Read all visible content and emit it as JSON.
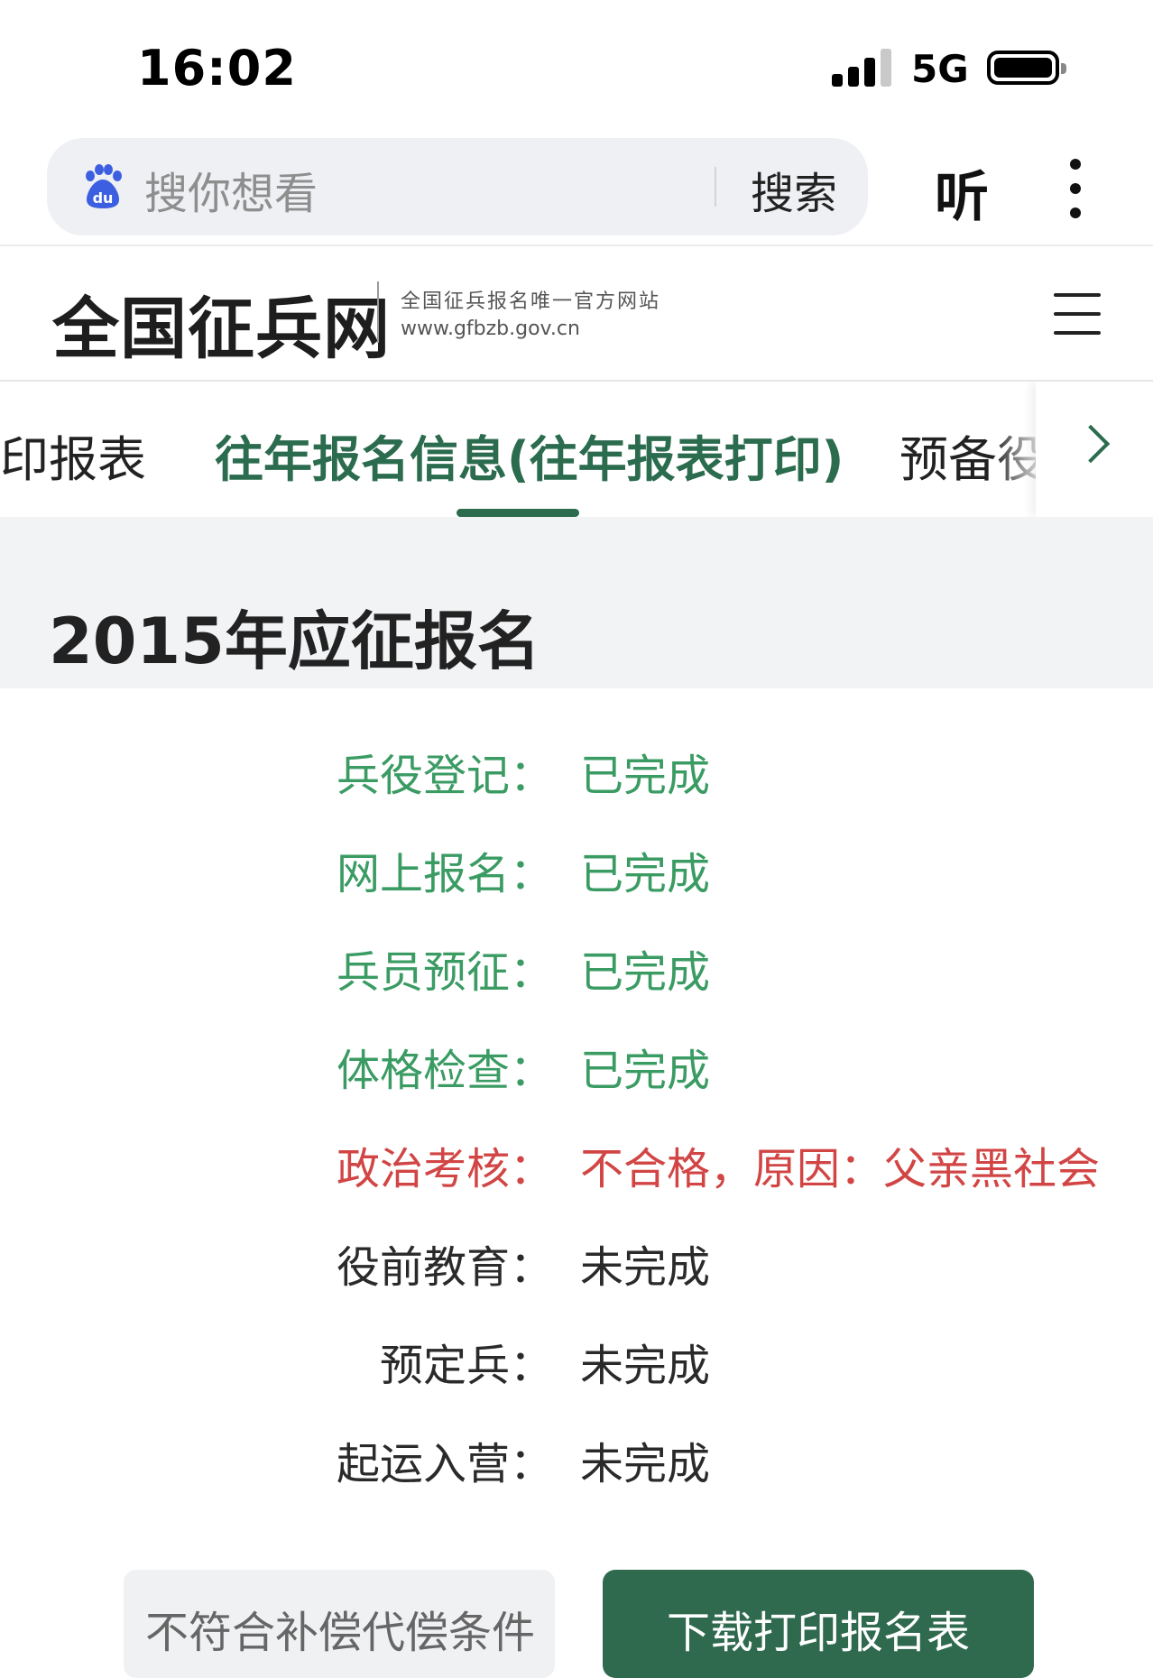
{
  "status_bar": {
    "time": "16:02",
    "network": "5G",
    "icons": [
      "signal-icon",
      "battery-icon"
    ]
  },
  "browser": {
    "search_placeholder": "搜你想看",
    "search_button": "搜索",
    "listen_button": "听",
    "icons": [
      "baidu-paw-icon",
      "more-vertical-icon"
    ]
  },
  "site": {
    "logo": "全国征兵网",
    "slogan": "全国征兵报名唯一官方网站",
    "url": "www.gfbzb.gov.cn",
    "menu_icon": "hamburger-menu-icon"
  },
  "tabs": [
    {
      "label": "印报表",
      "active": false
    },
    {
      "label": "往年报名信息(往年报表打印)",
      "active": true
    },
    {
      "label": "预备役",
      "active": false
    }
  ],
  "section": {
    "title": "2015年应征报名"
  },
  "statuses": [
    {
      "label": "兵役登记：",
      "value": "已完成",
      "state": "done"
    },
    {
      "label": "网上报名：",
      "value": "已完成",
      "state": "done"
    },
    {
      "label": "兵员预征：",
      "value": "已完成",
      "state": "done"
    },
    {
      "label": "体格检查：",
      "value": "已完成",
      "state": "done"
    },
    {
      "label": "政治考核：",
      "value": "不合格，原因：父亲黑社会",
      "state": "fail"
    },
    {
      "label": "役前教育：",
      "value": "未完成",
      "state": "pending"
    },
    {
      "label": "预定兵：",
      "value": "未完成",
      "state": "pending"
    },
    {
      "label": "起运入营：",
      "value": "未完成",
      "state": "pending"
    }
  ],
  "buttons": {
    "compensation": "不符合补偿代偿条件",
    "download": "下载打印报名表"
  },
  "colors": {
    "brand_green": "#2b6b4e",
    "done_green": "#3a9b63",
    "fail_red": "#d24545"
  }
}
